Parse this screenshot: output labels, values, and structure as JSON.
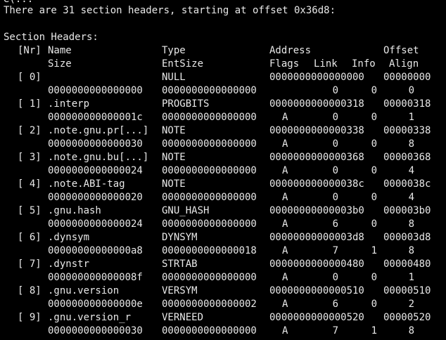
{
  "colors": {
    "background": "#000000",
    "foreground": "#e8e8e8"
  },
  "terminal": {
    "partial_top": "e(...",
    "intro": "There are 31 section headers, starting at offset 0x36d8:",
    "section_title": "Section Headers:",
    "header1": {
      "nr": "[Nr]",
      "name": "Name",
      "type": "Type",
      "address": "Address",
      "offset": "Offset"
    },
    "header2": {
      "size": "Size",
      "entsize": "EntSize",
      "flags": "Flags",
      "link": "Link",
      "info": "Info",
      "align": "Align"
    },
    "sections": [
      {
        "nr": "[ 0]",
        "name": "",
        "type": "NULL",
        "address": "0000000000000000",
        "offset": "00000000",
        "size": "0000000000000000",
        "entsize": "0000000000000000",
        "flags": "",
        "link": "0",
        "info": "0",
        "align": "0"
      },
      {
        "nr": "[ 1]",
        "name": ".interp",
        "type": "PROGBITS",
        "address": "0000000000000318",
        "offset": "00000318",
        "size": "000000000000001c",
        "entsize": "0000000000000000",
        "flags": "A",
        "link": "0",
        "info": "0",
        "align": "1"
      },
      {
        "nr": "[ 2]",
        "name": ".note.gnu.pr[...]",
        "type": "NOTE",
        "address": "0000000000000338",
        "offset": "00000338",
        "size": "0000000000000030",
        "entsize": "0000000000000000",
        "flags": "A",
        "link": "0",
        "info": "0",
        "align": "8"
      },
      {
        "nr": "[ 3]",
        "name": ".note.gnu.bu[...]",
        "type": "NOTE",
        "address": "0000000000000368",
        "offset": "00000368",
        "size": "0000000000000024",
        "entsize": "0000000000000000",
        "flags": "A",
        "link": "0",
        "info": "0",
        "align": "4"
      },
      {
        "nr": "[ 4]",
        "name": ".note.ABI-tag",
        "type": "NOTE",
        "address": "000000000000038c",
        "offset": "0000038c",
        "size": "0000000000000020",
        "entsize": "0000000000000000",
        "flags": "A",
        "link": "0",
        "info": "0",
        "align": "4"
      },
      {
        "nr": "[ 5]",
        "name": ".gnu.hash",
        "type": "GNU_HASH",
        "address": "00000000000003b0",
        "offset": "000003b0",
        "size": "0000000000000024",
        "entsize": "0000000000000000",
        "flags": "A",
        "link": "6",
        "info": "0",
        "align": "8"
      },
      {
        "nr": "[ 6]",
        "name": ".dynsym",
        "type": "DYNSYM",
        "address": "00000000000003d8",
        "offset": "000003d8",
        "size": "00000000000000a8",
        "entsize": "0000000000000018",
        "flags": "A",
        "link": "7",
        "info": "1",
        "align": "8"
      },
      {
        "nr": "[ 7]",
        "name": ".dynstr",
        "type": "STRTAB",
        "address": "0000000000000480",
        "offset": "00000480",
        "size": "000000000000008f",
        "entsize": "0000000000000000",
        "flags": "A",
        "link": "0",
        "info": "0",
        "align": "1"
      },
      {
        "nr": "[ 8]",
        "name": ".gnu.version",
        "type": "VERSYM",
        "address": "0000000000000510",
        "offset": "00000510",
        "size": "000000000000000e",
        "entsize": "0000000000000002",
        "flags": "A",
        "link": "6",
        "info": "0",
        "align": "2"
      },
      {
        "nr": "[ 9]",
        "name": ".gnu.version_r",
        "type": "VERNEED",
        "address": "0000000000000520",
        "offset": "00000520",
        "size": "0000000000000030",
        "entsize": "0000000000000000",
        "flags": "A",
        "link": "7",
        "info": "1",
        "align": "8"
      }
    ]
  }
}
